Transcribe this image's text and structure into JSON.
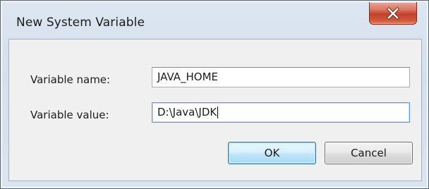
{
  "window": {
    "title": "New System Variable",
    "close_icon": "close-x-icon",
    "accent_close": "#c2412a"
  },
  "form": {
    "name_label": "Variable name:",
    "name_value": "JAVA_HOME",
    "value_label": "Variable value:",
    "value_value": "D:\\Java\\JDK"
  },
  "buttons": {
    "ok_label": "OK",
    "cancel_label": "Cancel"
  }
}
